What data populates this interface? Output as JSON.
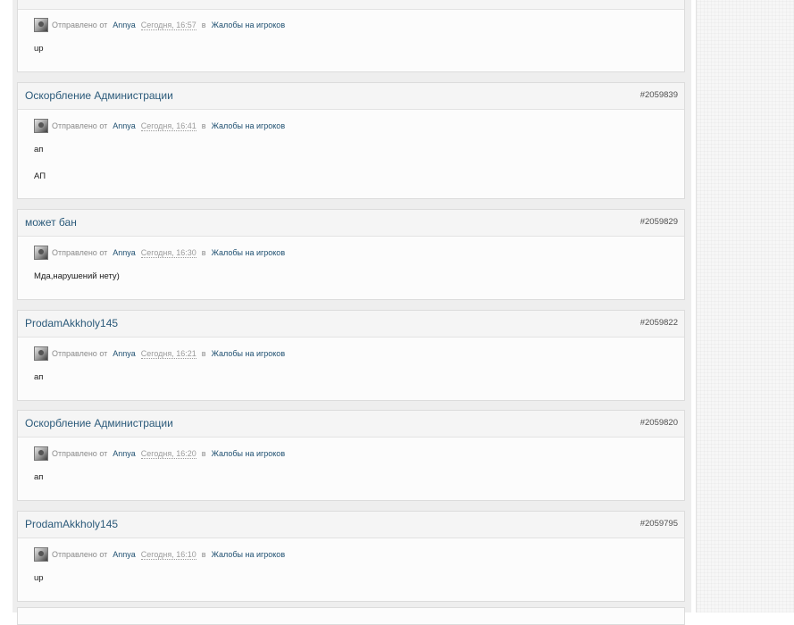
{
  "meta_labels": {
    "posted_by": "Отправлено от",
    "in": "в"
  },
  "posts": [
    {
      "title": "",
      "id": "",
      "author": "Annya",
      "time": "Сегодня, 16:57",
      "forum": "Жалобы на игроков",
      "lines": [
        "up"
      ]
    },
    {
      "title": "Оскорбление Администрации",
      "id": "#2059839",
      "author": "Annya",
      "time": "Сегодня, 16:41",
      "forum": "Жалобы на игроков",
      "lines": [
        "ап",
        "АП"
      ]
    },
    {
      "title": "может бан",
      "id": "#2059829",
      "author": "Annya",
      "time": "Сегодня, 16:30",
      "forum": "Жалобы на игроков",
      "lines": [
        "Мда,нарушений нету)"
      ]
    },
    {
      "title": "ProdamAkkholy145",
      "id": "#2059822",
      "author": "Annya",
      "time": "Сегодня, 16:21",
      "forum": "Жалобы на игроков",
      "lines": [
        "ап"
      ]
    },
    {
      "title": "Оскорбление Администрации",
      "id": "#2059820",
      "author": "Annya",
      "time": "Сегодня, 16:20",
      "forum": "Жалобы на игроков",
      "lines": [
        "ап"
      ]
    },
    {
      "title": "ProdamAkkholy145",
      "id": "#2059795",
      "author": "Annya",
      "time": "Сегодня, 16:10",
      "forum": "Жалобы на игроков",
      "lines": [
        "up"
      ]
    }
  ]
}
